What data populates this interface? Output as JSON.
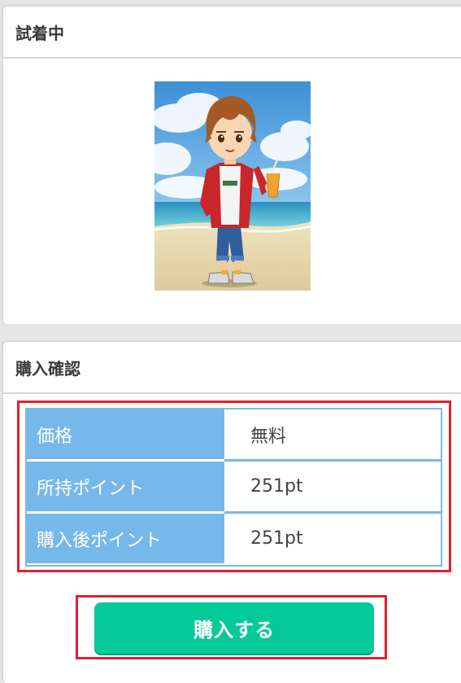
{
  "tryon": {
    "title": "試着中"
  },
  "purchase": {
    "title": "購入確認",
    "rows": [
      {
        "label": "価格",
        "value": "無料"
      },
      {
        "label": "所持ポイント",
        "value": "251pt"
      },
      {
        "label": "購入後ポイント",
        "value": "251pt"
      }
    ],
    "buy_label": "購入する"
  },
  "colors": {
    "table_label_bg": "#77b8ea",
    "button_bg": "#04c999",
    "highlight_border": "#e0202c"
  }
}
